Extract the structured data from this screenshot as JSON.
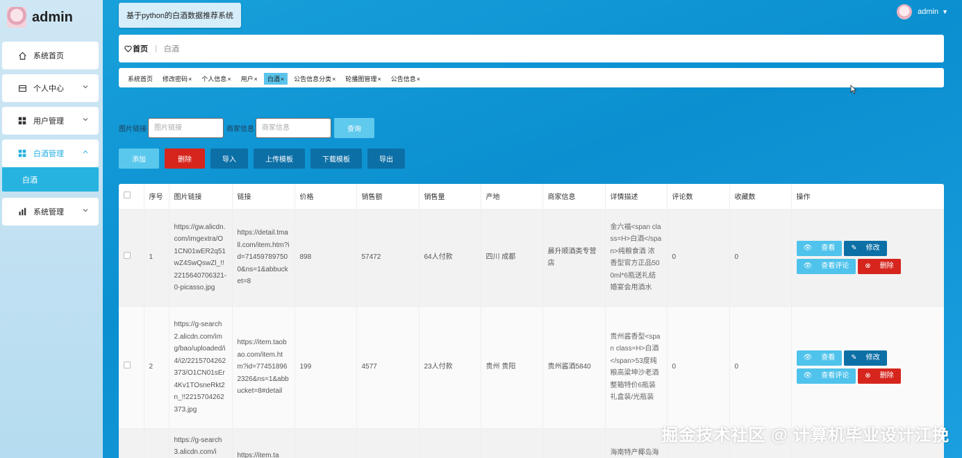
{
  "brand": {
    "title": "admin"
  },
  "header": {
    "system_title": "基于python的白酒数据推荐系统",
    "user_name": "admin"
  },
  "sidebar": {
    "items": [
      {
        "label": "系统首页",
        "icon": "home-icon"
      },
      {
        "label": "个人中心",
        "icon": "card-icon"
      },
      {
        "label": "用户管理",
        "icon": "grid-icon"
      },
      {
        "label": "白酒管理",
        "icon": "grid-icon"
      },
      {
        "label": "系统管理",
        "icon": "bar-chart-icon"
      }
    ],
    "sub_item": "白酒"
  },
  "breadcrumb": {
    "home": "首页",
    "separator": "|",
    "current": "白酒"
  },
  "tabs": [
    {
      "label": "系统首页",
      "closable": false
    },
    {
      "label": "修改密码",
      "closable": true
    },
    {
      "label": "个人信息",
      "closable": true
    },
    {
      "label": "用户",
      "closable": true
    },
    {
      "label": "白酒",
      "closable": true
    },
    {
      "label": "公告信息分类",
      "closable": true
    },
    {
      "label": "轮播图管理",
      "closable": true
    },
    {
      "label": "公告信息",
      "closable": true
    }
  ],
  "tab_close": "×",
  "search": {
    "image_label": "图片链接",
    "image_placeholder": "图片链接",
    "merchant_label": "商家信息",
    "merchant_placeholder": "商家信息",
    "query_button": "查询"
  },
  "actions": {
    "add": "添加",
    "delete": "删除",
    "import": "导入",
    "upload_template": "上传模板",
    "download_template": "下载模板",
    "export": "导出"
  },
  "table": {
    "headers": [
      "",
      "序号",
      "图片链接",
      "链接",
      "价格",
      "销售额",
      "销售量",
      "产地",
      "商家信息",
      "详情描述",
      "评论数",
      "收藏数",
      "操作"
    ],
    "rows": [
      {
        "index": "1",
        "image": "https://gw.alicdn.com/imgextra/O1CN01wER2q51wZ4SwQswZl_!!2215640706321-0-picasso.jpg",
        "link": "https://detail.tmall.com/item.htm?id=714597897500&ns=1&abbucket=8",
        "price": "898",
        "sales_amount": "57472",
        "sales_volume": "64人付款",
        "origin": "四川 成都",
        "merchant": "晨升顺酒类专营店",
        "desc": "金六福<span class=H>白酒</span>纯粮食酒 浓香型官方正品500ml*6瓶送礼结婚宴会用酒水",
        "comments": "0",
        "favorites": "0"
      },
      {
        "index": "2",
        "image": "https://g-search2.alicdn.com/img/bao/uploaded/i4/i2/2215704262373/O1CN01sEr4Kv1TOsneRkt2n_!!2215704262373.jpg",
        "link": "https://item.taobao.com/item.htm?id=774518962326&ns=1&abbucket=8#detail",
        "price": "199",
        "sales_amount": "4577",
        "sales_volume": "23人付款",
        "origin": "贵州 贵阳",
        "merchant": "贵州酱酒5840",
        "desc": "贵州酱香型<span class=H>白酒</span>53度纯粮高粱坤沙老酒整箱特价6瓶装礼盒装/光瓶装",
        "comments": "0",
        "favorites": "0"
      },
      {
        "image": "https://g-search3.alicdn.com/i",
        "link": "https://item.ta",
        "desc": "海南特产椰岛海"
      }
    ],
    "ops": {
      "view": "查看",
      "edit": "修改",
      "comments": "查看评论",
      "delete": "删除"
    }
  },
  "watermark": "掘金技术社区 @ 计算机毕业设计江挽",
  "colors": {
    "accent": "#26b3e0",
    "primary_dark": "#0c6fa6",
    "danger": "#d6251d",
    "light_button": "#5fcaed"
  }
}
